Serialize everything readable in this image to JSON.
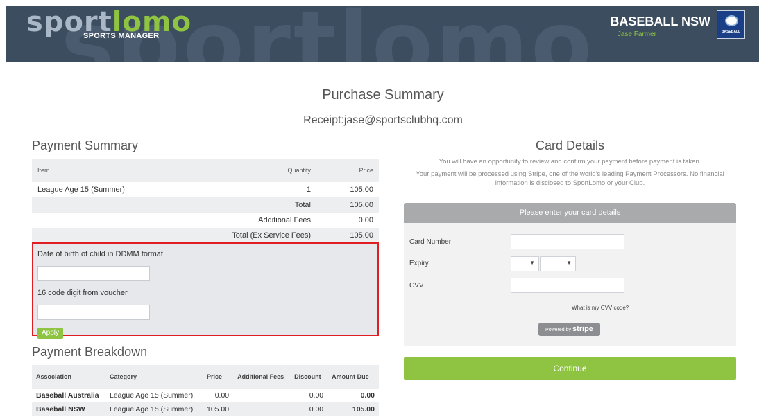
{
  "header": {
    "logo_part1": "sport",
    "logo_part2": "lomo",
    "logo_sub": "SPORTS MANAGER",
    "watermark": "sportlomo",
    "org_name": "BASEBALL NSW",
    "user_name": "Jase Farmer",
    "badge_text": "BASEBALL"
  },
  "page": {
    "title": "Purchase Summary",
    "receipt": "Receipt:jase@sportsclubhq.com"
  },
  "payment_summary": {
    "title": "Payment Summary",
    "columns": {
      "item": "Item",
      "quantity": "Quantity",
      "price": "Price"
    },
    "rows": [
      {
        "item": "League Age 15 (Summer)",
        "quantity": "1",
        "price": "105.00"
      }
    ],
    "totals": [
      {
        "label": "Total",
        "value": "105.00"
      },
      {
        "label": "Additional Fees",
        "value": "0.00"
      },
      {
        "label": "Total (Ex Service Fees)",
        "value": "105.00"
      }
    ]
  },
  "voucher": {
    "dob_label": "Date of birth of child in DDMM format",
    "dob_value": "",
    "code_label": "16 code digit from voucher",
    "code_value": "",
    "apply_label": "Apply"
  },
  "payment_breakdown": {
    "title": "Payment Breakdown",
    "columns": [
      "Association",
      "Category",
      "Price",
      "Additional Fees",
      "Discount",
      "Amount Due"
    ],
    "rows": [
      {
        "association": "Baseball Australia",
        "category": "League Age 15 (Summer)",
        "price": "0.00",
        "additional_fees": "",
        "discount": "0.00",
        "amount_due": "0.00"
      },
      {
        "association": "Baseball NSW",
        "category": "League Age 15 (Summer)",
        "price": "105.00",
        "additional_fees": "",
        "discount": "0.00",
        "amount_due": "105.00"
      }
    ]
  },
  "card": {
    "title": "Card Details",
    "note1": "You will have an opportunity to review and confirm your payment before payment is taken.",
    "note2": "Your payment will be processed using Stripe, one of the world's leading Payment Processors. No financial information is disclosed to SportLomo or your Club.",
    "panel_title": "Please enter your card details",
    "card_number_label": "Card Number",
    "expiry_label": "Expiry",
    "cvv_label": "CVV",
    "cvv_help": "What is my CVV code?",
    "powered_by": "Powered by",
    "stripe_brand": "stripe",
    "continue_label": "Continue"
  },
  "colors": {
    "header_bg": "#3c4d60",
    "accent_green": "#8fc443",
    "highlight_red": "#e21c23"
  },
  "icons": {
    "dropdown": "chevron-down-icon",
    "org_badge": "baseball-nsw-logo"
  }
}
